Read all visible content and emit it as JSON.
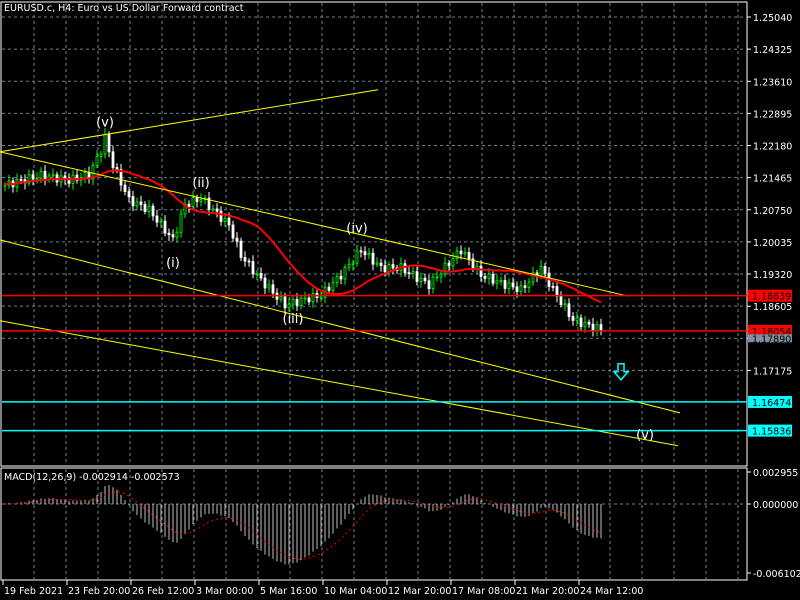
{
  "title": "EURUSD.c, H4:  Euro vs US Dollar Forward contract",
  "colors": {
    "bull": "#00ff00",
    "bear": "#ffffff",
    "ma": "#ff0000",
    "trend": "#ffff00",
    "support": "#ff0000",
    "target": "#00ffff",
    "grid": "#6f7f8f",
    "macd_hist": "#c0c0c0",
    "macd_signal": "#ff0000"
  },
  "chart_data": {
    "type": "candlestick",
    "symbol": "EURUSD.c",
    "timeframe": "H4",
    "ylim": [
      1.156,
      1.254
    ],
    "yticks": [
      "1.25040",
      "1.24325",
      "1.23610",
      "1.22895",
      "1.22180",
      "1.21465",
      "1.20750",
      "1.20035",
      "1.19320",
      "1.18605",
      "1.17890",
      "1.17175",
      "1.16474",
      "1.15836"
    ],
    "ytick_values": [
      1.2504,
      1.24325,
      1.2361,
      1.22895,
      1.2218,
      1.21465,
      1.2075,
      1.20035,
      1.1932,
      1.18605,
      1.1789,
      1.17175
    ],
    "xticks": [
      "19 Feb 2021",
      "23 Feb 20:00",
      "26 Feb 12:00",
      "3 Mar 00:00",
      "5 Mar 16:00",
      "10 Mar 04:00",
      "12 Mar 20:00",
      "17 Mar 08:00",
      "21 Mar 20:00",
      "24 Mar 12:00"
    ],
    "bars_per_xtick": 16,
    "bar_count": 150,
    "price_path": [
      [
        0,
        1.213
      ],
      [
        9,
        1.2152
      ],
      [
        16,
        1.2141
      ],
      [
        21,
        1.2152
      ],
      [
        24,
        1.2208
      ],
      [
        25,
        1.2235
      ],
      [
        27,
        1.2175
      ],
      [
        31,
        1.2097
      ],
      [
        36,
        1.2075
      ],
      [
        39,
        1.2041
      ],
      [
        42,
        1.2008
      ],
      [
        45,
        1.2086
      ],
      [
        49,
        1.2101
      ],
      [
        52,
        1.2075
      ],
      [
        56,
        1.2041
      ],
      [
        59,
        1.1974
      ],
      [
        64,
        1.1919
      ],
      [
        70,
        1.1863
      ],
      [
        74,
        1.1874
      ],
      [
        79,
        1.1885
      ],
      [
        84,
        1.193
      ],
      [
        89,
        1.1986
      ],
      [
        94,
        1.1946
      ],
      [
        99,
        1.1946
      ],
      [
        106,
        1.1908
      ],
      [
        114,
        1.1986
      ],
      [
        119,
        1.193
      ],
      [
        124,
        1.1912
      ],
      [
        129,
        1.1897
      ],
      [
        134,
        1.1946
      ],
      [
        137,
        1.1897
      ],
      [
        142,
        1.183
      ],
      [
        149,
        1.1808
      ]
    ],
    "horizontal_lines": [
      {
        "price": 1.18839,
        "label": "1.18839",
        "kind": "support"
      },
      {
        "price": 1.18054,
        "label": "1.18054",
        "kind": "support"
      },
      {
        "price": 1.16474,
        "label": "1.16474",
        "kind": "target"
      },
      {
        "price": 1.15836,
        "label": "1.15836",
        "kind": "target"
      }
    ],
    "bid_label": "1.17890",
    "trendlines": [
      [
        [
          -1.25,
          1.2204
        ],
        [
          93.25,
          1.2342
        ]
      ],
      [
        [
          -1.25,
          1.2204
        ],
        [
          155.75,
          1.1883
        ]
      ],
      [
        [
          -1.25,
          1.2008
        ],
        [
          168.75,
          1.1623
        ]
      ],
      [
        [
          -1.25,
          1.1828
        ],
        [
          168.25,
          1.155
        ]
      ]
    ],
    "wave_labels": [
      {
        "text": "(v)",
        "bar": 25,
        "price": 1.226
      },
      {
        "text": "(ii)",
        "bar": 49,
        "price": 1.2126
      },
      {
        "text": "(i)",
        "bar": 42,
        "price": 1.1948
      },
      {
        "text": "(iii)",
        "bar": 72,
        "price": 1.1823
      },
      {
        "text": "(iv)",
        "bar": 88,
        "price": 1.2024
      },
      {
        "text": "(v)",
        "bar": 160,
        "price": 1.1565
      }
    ],
    "arrow": {
      "direction": "down",
      "bar": 154,
      "price": 1.171
    },
    "ma_period": 20,
    "macd": {
      "label": "MACD(12,26,9) -0.002914 -0.002573",
      "fast": 12,
      "slow": 26,
      "signal": 9,
      "value": -0.002914,
      "signal_value": -0.002573,
      "ylim": [
        -0.006102,
        0.002955
      ],
      "yticks": [
        "0.002955",
        "0.000000",
        "-0.006102"
      ]
    }
  }
}
